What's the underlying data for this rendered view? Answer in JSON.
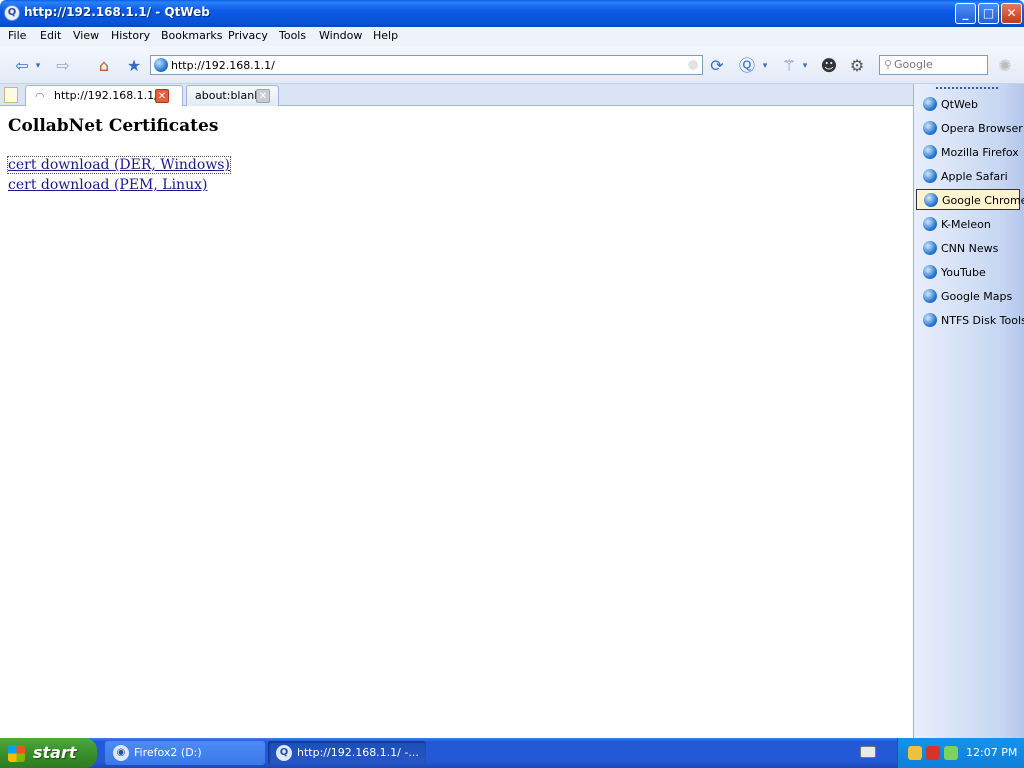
{
  "window": {
    "title": "http://192.168.1.1/ - QtWeb"
  },
  "menubar": [
    "File",
    "Edit",
    "View",
    "History",
    "Bookmarks",
    "Privacy",
    "Tools",
    "Window",
    "Help"
  ],
  "address_bar": {
    "url": "http://192.168.1.1/"
  },
  "search": {
    "placeholder": "Google"
  },
  "tabs": [
    {
      "label": "http://192.168.1.1/",
      "active": true
    },
    {
      "label": "about:blank",
      "active": false
    }
  ],
  "page": {
    "heading": "CollabNet Certificates",
    "links": [
      "cert download (DER, Windows)",
      "cert download (PEM, Linux)"
    ]
  },
  "bookmarks": [
    "QtWeb",
    "Opera Browser",
    "Mozilla Firefox",
    "Apple Safari",
    "Google Chrome",
    "K-Meleon",
    "CNN News",
    "YouTube",
    "Google Maps",
    "NTFS Disk Tools"
  ],
  "taskbar": {
    "start_label": "start",
    "tasks": [
      "Firefox2 (D:)",
      "http://192.168.1.1/ -..."
    ],
    "clock": "12:07 PM"
  },
  "colors": {
    "titlebar": "#0a5ef0",
    "taskbar": "#2459d6",
    "start": "#3a8f2b",
    "link": "#1a1a8a"
  }
}
